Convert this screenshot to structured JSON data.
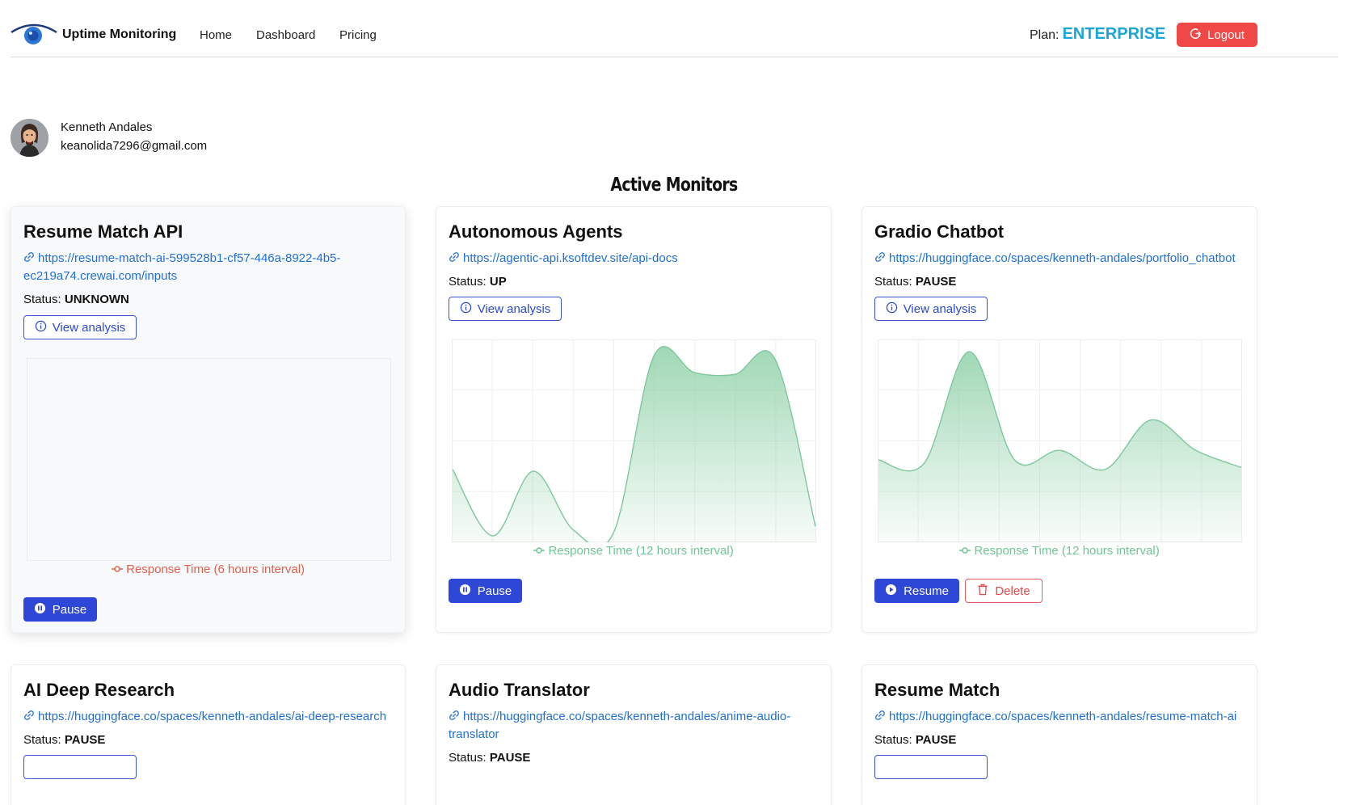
{
  "nav": {
    "brand": "Uptime Monitoring",
    "links": [
      "Home",
      "Dashboard",
      "Pricing"
    ],
    "plan_label": "Plan:",
    "plan_value": "ENTERPRISE",
    "logout_label": "Logout"
  },
  "user": {
    "name": "Kenneth Andales",
    "email": "keanolida7296@gmail.com"
  },
  "section_title": "Active Monitors",
  "labels": {
    "view_analysis": "View analysis",
    "status_prefix": "Status:",
    "pause": "Pause",
    "resume": "Resume",
    "delete": "Delete"
  },
  "monitors": [
    {
      "title": "Resume Match API",
      "url": "https://resume-match-ai-599528b1-cf57-446a-8922-4b5-ec219a74.crewai.com/inputs",
      "url_lines": [
        "https://resume-match-ai-599528b1-cf57-446a-8922-4b5-",
        "ec219a74.crewai.com/inputs"
      ],
      "status": "UNKNOWN",
      "legend": "Response Time (6 hours interval)",
      "legend_color": "#e0604e",
      "action": "Pause",
      "has_delete": false
    },
    {
      "title": "Autonomous Agents",
      "url": "https://agentic-api.ksoftdev.site/api-docs",
      "url_lines": [
        "https://agentic-api.ksoftdev.site/api-docs"
      ],
      "status": "UP",
      "legend": "Response Time (12 hours interval)",
      "legend_color": "#6fc595",
      "action": "Pause",
      "has_delete": false
    },
    {
      "title": "Gradio Chatbot",
      "url": "https://huggingface.co/spaces/kenneth-andales/portfolio_chatbot",
      "url_lines": [
        "https://huggingface.co/spaces/kenneth-andales/portfolio_chatbot"
      ],
      "status": "PAUSE",
      "legend": "Response Time (12 hours interval)",
      "legend_color": "#6fc595",
      "action": "Resume",
      "has_delete": true
    },
    {
      "title": "AI Deep Research",
      "url": "https://huggingface.co/spaces/kenneth-andales/ai-deep-research",
      "url_lines": [
        "https://huggingface.co/spaces/kenneth-andales/ai-deep-research"
      ],
      "status": "PAUSE"
    },
    {
      "title": "Audio Translator",
      "url": "https://huggingface.co/spaces/kenneth-andales/anime-audio-translator",
      "url_lines": [
        "https://huggingface.co/spaces/kenneth-andales/anime-audio-",
        "translator"
      ],
      "status": "PAUSE"
    },
    {
      "title": "Resume Match",
      "url": "https://huggingface.co/spaces/kenneth-andales/resume-match-ai",
      "url_lines": [
        "https://huggingface.co/spaces/kenneth-andales/resume-match-ai"
      ],
      "status": "PAUSE"
    }
  ],
  "colors": {
    "accent": "#2e47d6",
    "plan": "#1aa6d6",
    "logout": "#f04747",
    "link": "#1f6fd1",
    "area_fill": "#8fd1a8"
  },
  "chart_data": [
    {
      "type": "area",
      "series": [
        {
          "values": []
        }
      ]
    },
    {
      "type": "area",
      "series": [
        {
          "values": [
            0.35,
            0.0,
            0.34,
            0.03,
            0.02,
            0.95,
            0.86,
            0.85,
            0.93,
            0.05
          ]
        }
      ],
      "ylim": [
        0,
        1
      ],
      "grid": true
    },
    {
      "type": "area",
      "series": [
        {
          "values": [
            0.4,
            0.38,
            0.97,
            0.4,
            0.45,
            0.35,
            0.61,
            0.45,
            0.36
          ]
        }
      ],
      "ylim": [
        0,
        1
      ],
      "grid": true
    }
  ]
}
